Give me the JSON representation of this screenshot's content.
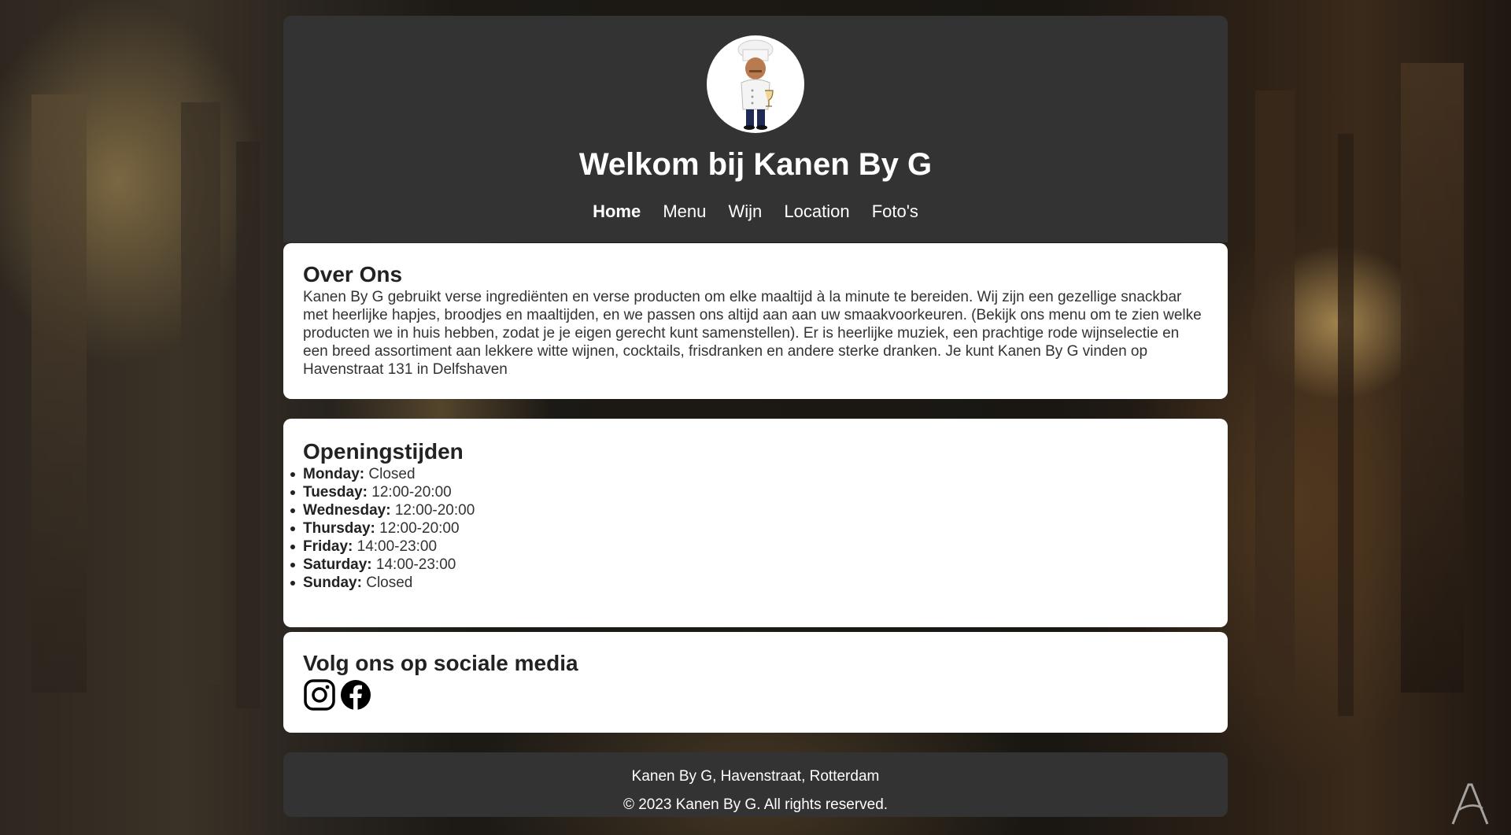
{
  "header": {
    "avatar_alt": "chef-avatar",
    "title": "Welkom bij Kanen By G",
    "nav": [
      {
        "label": "Home",
        "active": true
      },
      {
        "label": "Menu",
        "active": false
      },
      {
        "label": "Wijn",
        "active": false
      },
      {
        "label": "Location",
        "active": false
      },
      {
        "label": "Foto's",
        "active": false
      }
    ]
  },
  "about": {
    "heading": "Over Ons",
    "text": "Kanen By G gebruikt verse ingrediënten en verse producten om elke maaltijd à la minute te bereiden. Wij zijn een gezellige snackbar met heerlijke hapjes, broodjes en maaltijden, en we passen ons altijd aan aan uw smaakvoorkeuren. (Bekijk ons menu om te zien welke producten we in huis hebben, zodat je je eigen gerecht kunt samenstellen). Er is heerlijke muziek, een prachtige rode wijnselectie en een breed assortiment aan lekkere witte wijnen, cocktails, frisdranken en andere sterke dranken. Je kunt Kanen By G vinden op Havenstraat 131 in Delfshaven"
  },
  "hours": {
    "heading": "Openingstijden",
    "days": [
      {
        "day": "Monday:",
        "time": "Closed"
      },
      {
        "day": "Tuesday:",
        "time": "12:00-20:00"
      },
      {
        "day": "Wednesday:",
        "time": "12:00-20:00"
      },
      {
        "day": "Thursday:",
        "time": "12:00-20:00"
      },
      {
        "day": "Friday:",
        "time": "14:00-23:00"
      },
      {
        "day": "Saturday:",
        "time": "14:00-23:00"
      },
      {
        "day": "Sunday:",
        "time": "Closed"
      }
    ]
  },
  "social": {
    "heading": "Volg ons op sociale media",
    "icons": [
      "instagram-icon",
      "facebook-icon"
    ]
  },
  "footer": {
    "address": "Kanen By G, Havenstraat, Rotterdam",
    "copyright": "© 2023 Kanen By G. All rights reserved."
  },
  "colors": {
    "header_bg": "#333333",
    "card_bg": "#ffffff",
    "text": "#222222"
  }
}
